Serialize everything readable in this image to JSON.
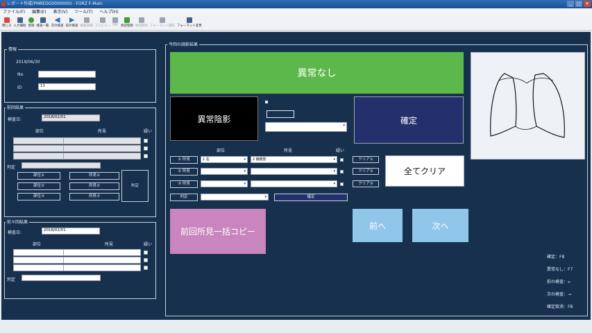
{
  "window": {
    "title": "レポート作成(PMREDG0000000) - FORZ F-Main",
    "controls": [
      "_",
      "□",
      "✕"
    ]
  },
  "menu": [
    "ファイル(F)",
    "編集(E)",
    "表示(V)",
    "ツール(T)",
    "ヘルプ(H)"
  ],
  "toolbar": [
    {
      "label": "閉じる",
      "color": "#d9473c",
      "enabled": true
    },
    {
      "label": "入力補助",
      "color": "#3f5f8f",
      "enabled": true
    },
    {
      "label": "登録",
      "color": "#3a9b3a",
      "enabled": true
    },
    {
      "label": "検査一覧",
      "color": "#3f5f8f",
      "enabled": true
    },
    {
      "label": "次の検査",
      "color": "#2a6fc6",
      "enabled": true
    },
    {
      "label": "前の検査",
      "color": "#2a6fc6",
      "enabled": true
    },
    {
      "label": "検査詳細",
      "color": "#9aa3ad",
      "enabled": false
    },
    {
      "label": "プレビュー",
      "color": "#9aa3ad",
      "enabled": false
    },
    {
      "label": "PDF",
      "color": "#9aa3ad",
      "enabled": false
    },
    {
      "label": "承認登録",
      "color": "#3a9b3a",
      "enabled": true
    },
    {
      "label": "承認削除",
      "color": "#9aa3ad",
      "enabled": false
    },
    {
      "label": "フォーマット選択",
      "color": "#9aa3ad",
      "enabled": false
    },
    {
      "label": "フォーマット変更",
      "color": "#3f5f8f",
      "enabled": true
    }
  ],
  "info": {
    "title": "情報",
    "date": "2019/06/30",
    "no_label": "No.",
    "no_value": "",
    "id_label": "ID",
    "id_value": "11"
  },
  "prev": {
    "title": "前回結果",
    "exam_date_label": "検査日:",
    "exam_date": "2018/02/01",
    "col_site": "部位",
    "col_finding": "所見",
    "col_doubt": "疑い",
    "judge_label": "判定",
    "site_buttons": [
      "部位①",
      "部位②",
      "部位③"
    ],
    "finding_buttons": [
      "所見①",
      "所見②",
      "所見③"
    ],
    "judge_button": "判定"
  },
  "prev2": {
    "title": "前々回結果",
    "exam_date_label": "検査日:",
    "exam_date": "2018/02/01",
    "col_site": "部位",
    "col_finding": "所見",
    "col_doubt": "疑い",
    "judge_label": "判定"
  },
  "current": {
    "title": "今回の読影結果",
    "normal_button": "異常なし",
    "abnormal_shadow_button": "異常陰影",
    "small_button": "",
    "confirm_button": "確定",
    "clear_all_button": "全てクリア",
    "col_site": "部位",
    "col_finding": "所見",
    "col_doubt": "疑い",
    "rows": [
      {
        "finding_btn": "① 所見",
        "site": "1 右",
        "finding": "2 瘢痕影",
        "clear_btn": "クリア①"
      },
      {
        "finding_btn": "② 所見",
        "site": "",
        "finding": "",
        "clear_btn": "クリア②"
      },
      {
        "finding_btn": "③ 所見",
        "site": "",
        "finding": "",
        "clear_btn": "クリア③"
      }
    ],
    "judge_btn": "判定",
    "judge_value": "",
    "judge_confirm": "確定",
    "copy_button": "前回所見一括コピー",
    "prev_button": "前へ",
    "next_button": "次へ"
  },
  "shortcuts": [
    "確定：F8",
    "異常なし：F7",
    "前の検査：←",
    "次の検査：→",
    "確定取消：F8"
  ],
  "colors": {
    "bg": "#16304e",
    "green": "#5cb84a",
    "navy": "#23306b",
    "pink": "#c985bd",
    "light_blue": "#8fc6ea"
  }
}
